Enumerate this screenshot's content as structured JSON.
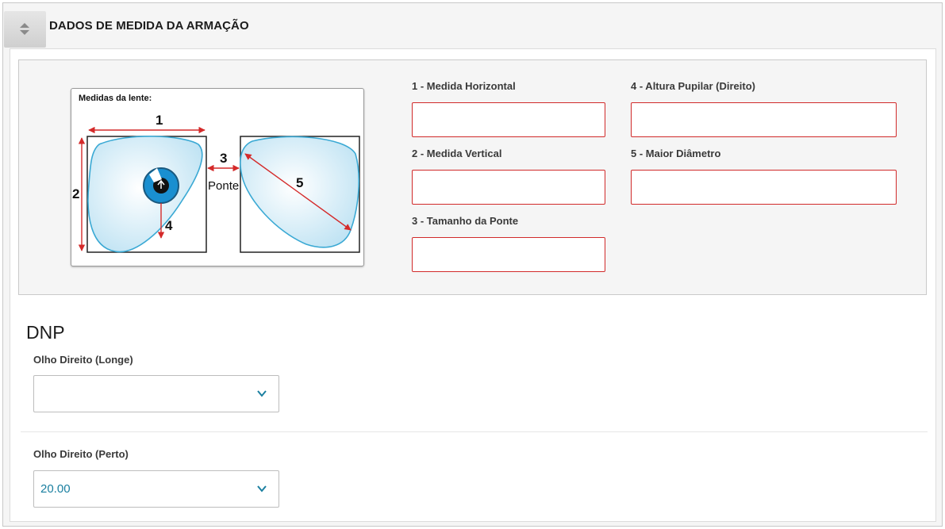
{
  "header": {
    "title": "DADOS DE MEDIDA DA ARMAÇÃO",
    "toggle_icon": "sort-arrows-icon"
  },
  "diagram": {
    "title": "Medidas da lente:",
    "labels": {
      "m1": "1",
      "m2": "2",
      "m3": "3",
      "ponte": "Ponte",
      "m4": "4",
      "m5": "5"
    }
  },
  "fields": {
    "horizontal": {
      "label": "1 - Medida Horizontal",
      "value": ""
    },
    "vertical": {
      "label": "2 - Medida Vertical",
      "value": ""
    },
    "ponte": {
      "label": "3 - Tamanho da Ponte",
      "value": ""
    },
    "altura": {
      "label": "4 - Altura Pupilar (Direito)",
      "value": ""
    },
    "diametro": {
      "label": "5 - Maior Diâmetro",
      "value": ""
    }
  },
  "dnp": {
    "title": "DNP",
    "longe": {
      "label": "Olho Direito (Longe)",
      "value": ""
    },
    "perto": {
      "label": "Olho Direito (Perto)",
      "value": "20.00"
    }
  },
  "colors": {
    "accent": "#1a7fa0",
    "error_border": "#d12a2a",
    "lens": "#3aa9d4",
    "arrow": "#d42a2a"
  }
}
